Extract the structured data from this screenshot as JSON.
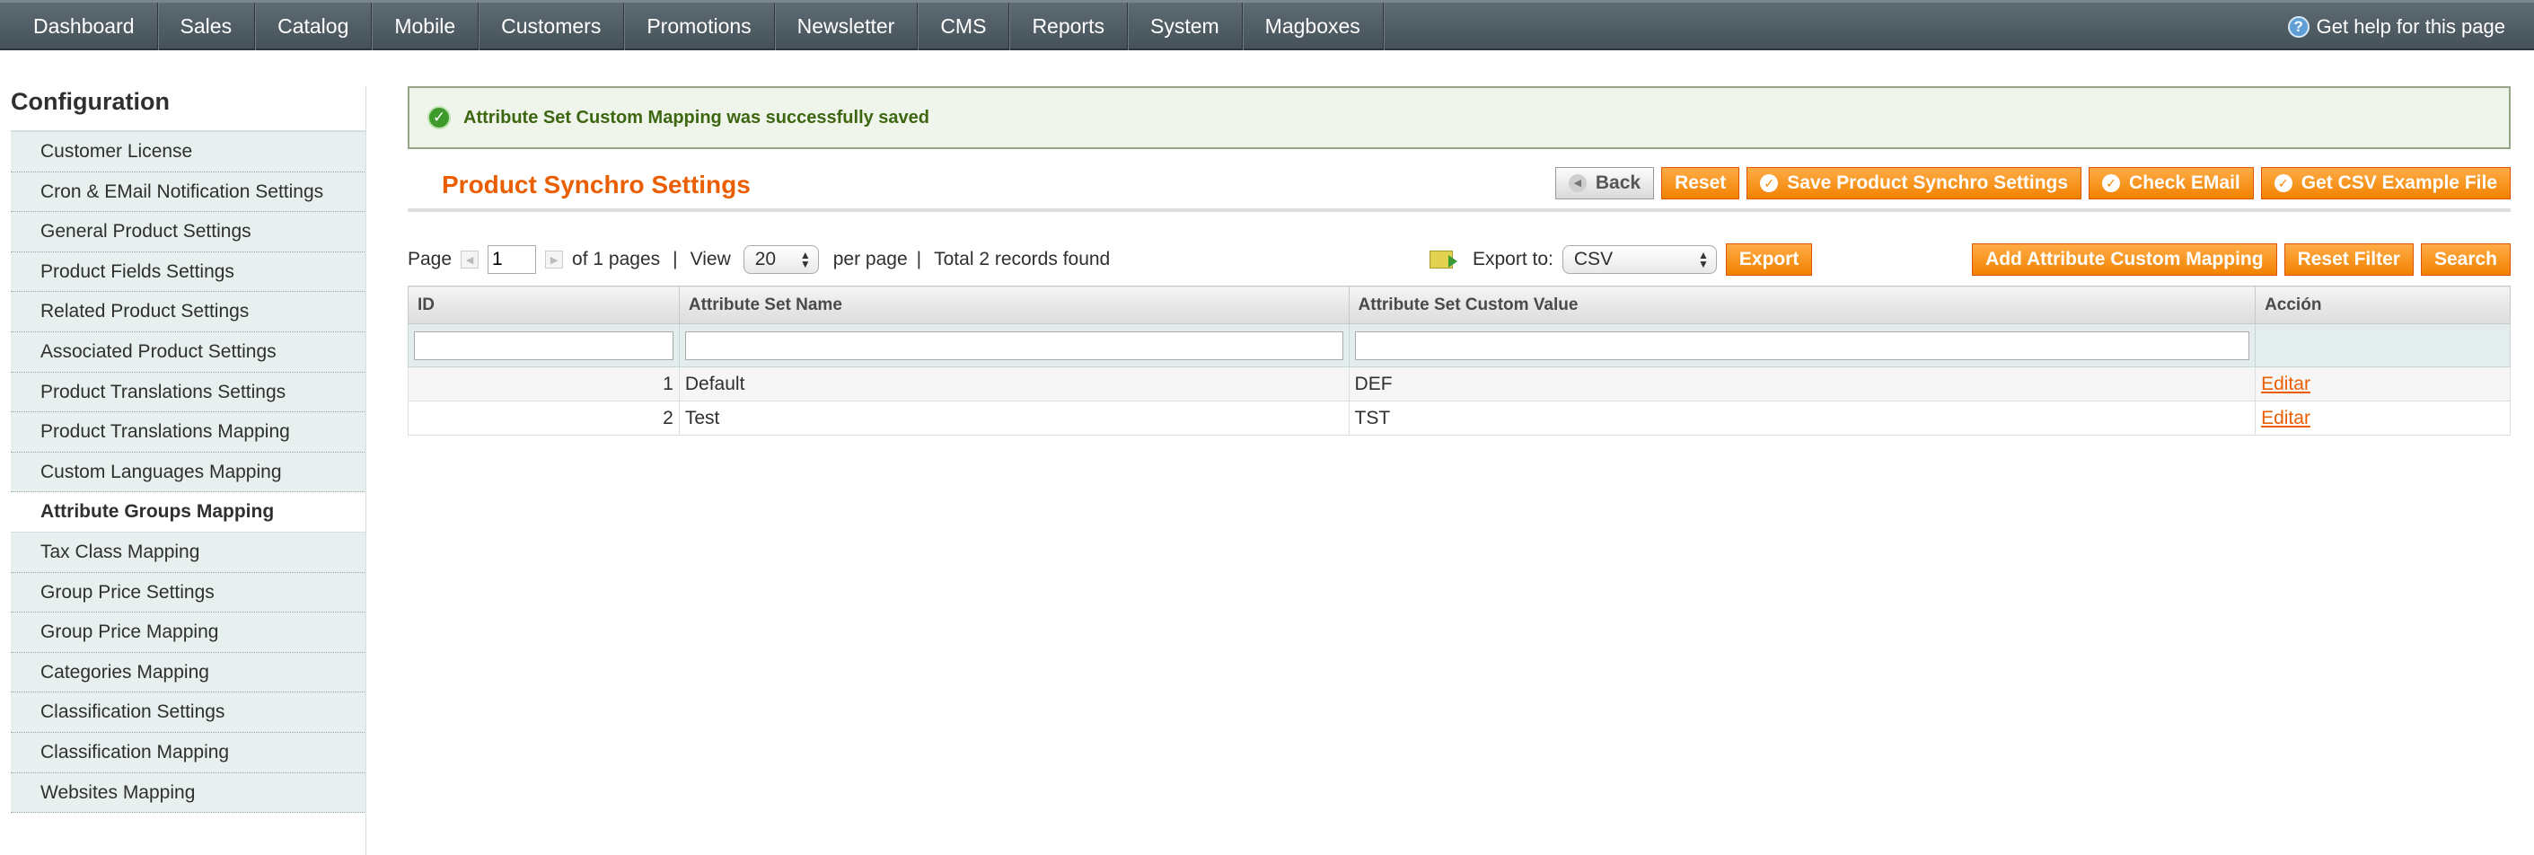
{
  "nav": {
    "items": [
      "Dashboard",
      "Sales",
      "Catalog",
      "Mobile",
      "Customers",
      "Promotions",
      "Newsletter",
      "CMS",
      "Reports",
      "System",
      "Magboxes"
    ],
    "help_label": "Get help for this page"
  },
  "sidebar": {
    "title": "Configuration",
    "items": [
      "Customer License",
      "Cron & EMail Notification Settings",
      "General Product Settings",
      "Product Fields Settings",
      "Related Product Settings",
      "Associated Product Settings",
      "Product Translations Settings",
      "Product Translations Mapping",
      "Custom Languages Mapping",
      "Attribute Groups Mapping",
      "Tax Class Mapping",
      "Group Price Settings",
      "Group Price Mapping",
      "Categories Mapping",
      "Classification Settings",
      "Classification Mapping",
      "Websites Mapping"
    ],
    "active_index": 9
  },
  "message": {
    "success": "Attribute Set Custom Mapping was successfully saved"
  },
  "header": {
    "title": "Product Synchro Settings",
    "buttons": {
      "back": "Back",
      "reset": "Reset",
      "save": "Save Product Synchro Settings",
      "check_email": "Check EMail",
      "csv_example": "Get CSV Example File"
    }
  },
  "pager": {
    "page_label": "Page",
    "page_value": "1",
    "of_pages": "of 1 pages",
    "separator": "|",
    "view_label": "View",
    "per_page_value": "20",
    "per_page_label": "per page",
    "total": "Total 2 records found"
  },
  "export": {
    "label": "Export to:",
    "format": "CSV",
    "button": "Export"
  },
  "grid_actions": {
    "add": "Add Attribute Custom Mapping",
    "reset_filter": "Reset Filter",
    "search": "Search"
  },
  "grid": {
    "columns": [
      "ID",
      "Attribute Set Name",
      "Attribute Set Custom Value",
      "Acción"
    ],
    "rows": [
      {
        "id": "1",
        "name": "Default",
        "value": "DEF",
        "action": "Editar"
      },
      {
        "id": "2",
        "name": "Test",
        "value": "TST",
        "action": "Editar"
      }
    ]
  },
  "colors": {
    "accent": "#eb5e00",
    "button": "#f18200",
    "nav_bg": "#515d65",
    "success_text": "#3d6611"
  }
}
